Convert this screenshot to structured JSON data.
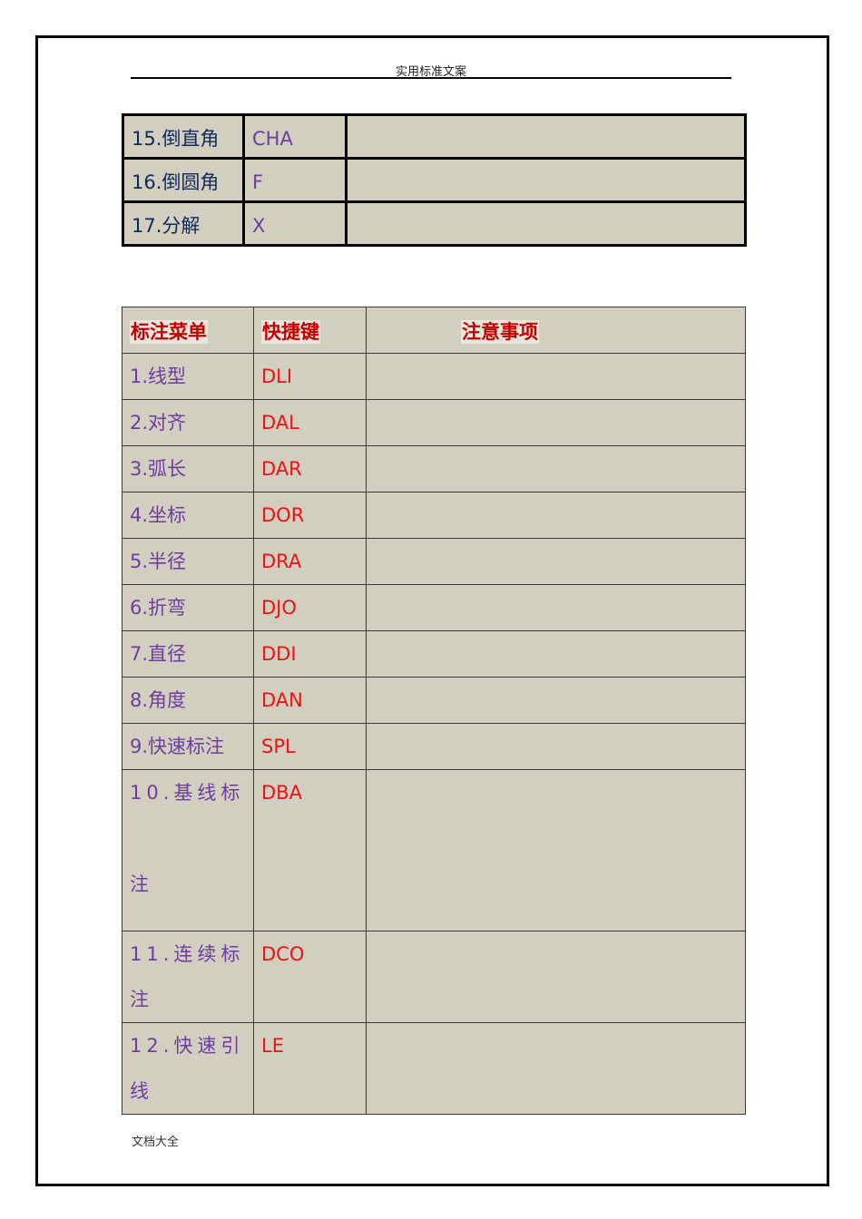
{
  "header": {
    "title": "实用标准文案"
  },
  "footer": {
    "text": "文档大全"
  },
  "edit_table": {
    "rows": [
      {
        "menu": "15.倒直角",
        "shortcut": "CHA",
        "note": ""
      },
      {
        "menu": "16.倒圆角",
        "shortcut": "F",
        "note": ""
      },
      {
        "menu": "17.分解",
        "shortcut": "X",
        "note": ""
      }
    ]
  },
  "dimension_table": {
    "headers": {
      "menu": "标注菜单",
      "shortcut": "快捷键",
      "note": "注意事项"
    },
    "rows": [
      {
        "menu": "1.线型",
        "shortcut": "DLI",
        "note": ""
      },
      {
        "menu": "2.对齐",
        "shortcut": "DAL",
        "note": ""
      },
      {
        "menu": "3.弧长",
        "shortcut": "DAR",
        "note": ""
      },
      {
        "menu": "4.坐标",
        "shortcut": "DOR",
        "note": ""
      },
      {
        "menu": "5.半径",
        "shortcut": "DRA",
        "note": ""
      },
      {
        "menu": "6.折弯",
        "shortcut": "DJO",
        "note": ""
      },
      {
        "menu": "7.直径",
        "shortcut": "DDI",
        "note": ""
      },
      {
        "menu": "8.角度",
        "shortcut": "DAN",
        "note": ""
      },
      {
        "menu": "9.快速标注",
        "shortcut": "SPL",
        "note": ""
      },
      {
        "menu": "10.基线标注",
        "shortcut": "DBA",
        "note": ""
      },
      {
        "menu": "11.连续标注",
        "shortcut": "DCO",
        "note": ""
      },
      {
        "menu": "12.快速引线",
        "shortcut": "LE",
        "note": ""
      }
    ]
  }
}
